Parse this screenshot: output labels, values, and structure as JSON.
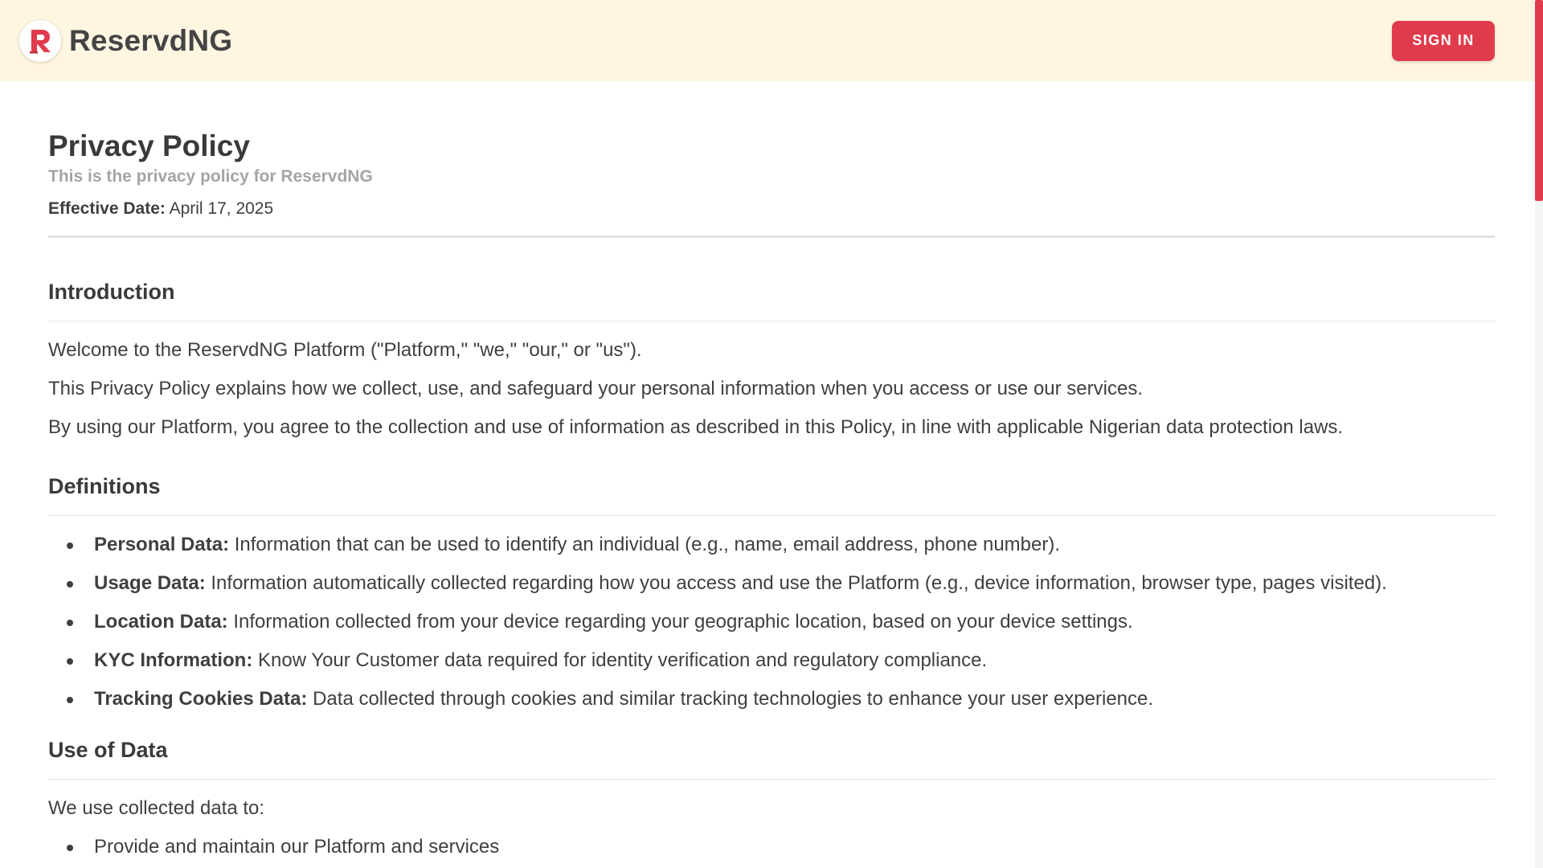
{
  "header": {
    "brand_name": "ReservdNG",
    "logo_letter": "R",
    "signin_label": "SIGN IN"
  },
  "colors": {
    "header_bg": "#fff6e2",
    "accent": "#e03b4c",
    "text": "#3f3f3f",
    "muted": "#a5a5a5"
  },
  "policy": {
    "title": "Privacy Policy",
    "subtitle": "This is the privacy policy for ReservdNG",
    "effective_label": "Effective Date:",
    "effective_date": "April 17, 2025"
  },
  "introduction": {
    "heading": "Introduction",
    "paragraphs": [
      "Welcome to the ReservdNG Platform (\"Platform,\" \"we,\" \"our,\" or \"us\").",
      "This Privacy Policy explains how we collect, use, and safeguard your personal information when you access or use our services.",
      "By using our Platform, you agree to the collection and use of information as described in this Policy, in line with applicable Nigerian data protection laws."
    ]
  },
  "definitions": {
    "heading": "Definitions",
    "items": [
      {
        "term": "Personal Data:",
        "text": "Information that can be used to identify an individual (e.g., name, email address, phone number)."
      },
      {
        "term": "Usage Data:",
        "text": "Information automatically collected regarding how you access and use the Platform (e.g., device information, browser type, pages visited)."
      },
      {
        "term": "Location Data:",
        "text": "Information collected from your device regarding your geographic location, based on your device settings."
      },
      {
        "term": "KYC Information:",
        "text": "Know Your Customer data required for identity verification and regulatory compliance."
      },
      {
        "term": "Tracking Cookies Data:",
        "text": "Data collected through cookies and similar tracking technologies to enhance your user experience."
      }
    ]
  },
  "use_of_data": {
    "heading": "Use of Data",
    "intro": "We use collected data to:",
    "items": [
      "Provide and maintain our Platform and services"
    ]
  }
}
